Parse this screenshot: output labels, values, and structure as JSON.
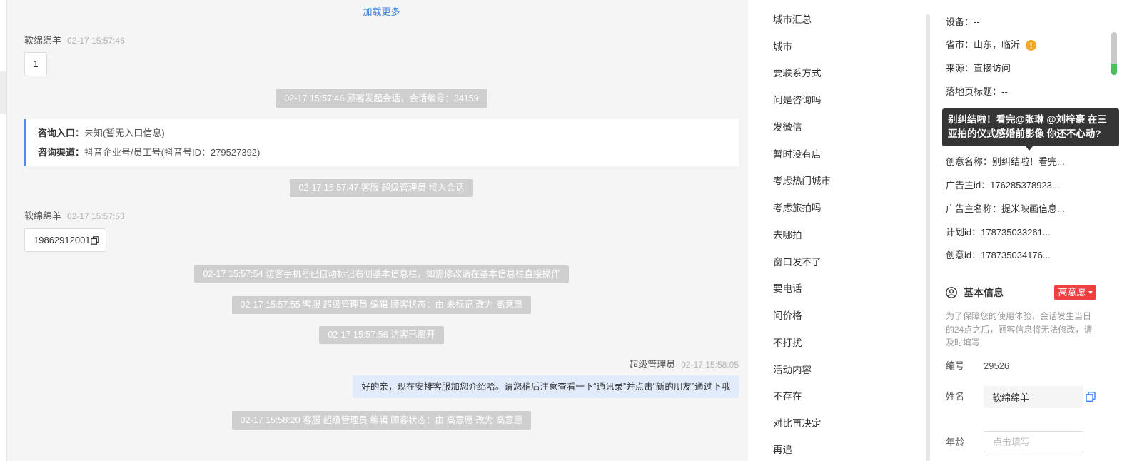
{
  "chat": {
    "load_more": "加载更多",
    "msg1": {
      "sender": "软绵绵羊",
      "time": "02-17 15:57:46",
      "text": "1"
    },
    "sys1": "02-17 15:57:46 顾客发起会话，会话编号：34159",
    "entry_info": {
      "entry_label": "咨询入口：",
      "entry_value": "未知(暂无入口信息)",
      "channel_label": "咨询渠道：",
      "channel_value": "抖音企业号/员工号(抖音号ID：279527392)"
    },
    "sys2": "02-17 15:57:47 客服 超级管理员 接入会话",
    "msg2": {
      "sender": "软绵绵羊",
      "time": "02-17 15:57:53",
      "text": "19862912001"
    },
    "sys3": "02-17 15:57:54 访客手机号已自动标记右侧基本信息栏，如需修改请在基本信息栏直接操作",
    "sys4": "02-17 15:57:55 客服 超级管理员 编辑 顾客状态：由 未标记 改为 高意愿",
    "sys5": "02-17 15:57:56 访客已离开",
    "msg3": {
      "sender": "超级管理员",
      "time": "02-17 15:58:05",
      "text": "好的亲，现在安排客服加您介绍哈。请您稍后注意查看一下“通讯录”并点击“新的朋友”通过下哦"
    },
    "sys6": "02-17 15:58:20 客服 超级管理员 编辑 顾客状态：由 高意愿 改为 高意愿"
  },
  "quick_replies": [
    "城市汇总",
    "城市",
    "要联系方式",
    "问是咨询吗",
    "发微信",
    "暂时没有店",
    "考虑热门城市",
    "考虑旅拍吗",
    "去哪拍",
    "窗口发不了",
    "要电话",
    "问价格",
    "不打扰",
    "活动内容",
    "不存在",
    "对比再决定",
    "再追"
  ],
  "customer_info": {
    "device": {
      "label": "设备：",
      "value": "--"
    },
    "province": {
      "label": "省市：",
      "value": "山东，临沂"
    },
    "source": {
      "label": "来源：",
      "value": "直接访问"
    },
    "landing_title": {
      "label": "落地页标题：",
      "value": "--"
    },
    "tooltip": "别纠结啦！看完@张琳 @刘梓豪 在三亚拍的仪式感婚前影像 你还不心动?",
    "creative_name": {
      "label": "创意名称：",
      "value": "别纠结啦！看完..."
    },
    "advertiser_id": {
      "label": "广告主id：",
      "value": "176285378923..."
    },
    "advertiser_name": {
      "label": "广告主名称：",
      "value": "提米映画信息..."
    },
    "plan_id": {
      "label": "计划id：",
      "value": "178735033261..."
    },
    "creative_id": {
      "label": "创意id：",
      "value": "178735034176..."
    },
    "basic_info": {
      "title": "基本信息",
      "status": "高意愿",
      "hint": "为了保障您的使用体验，会话发生当日的24点之后，顾客信息将无法修改，请及时填写"
    },
    "fields": {
      "number": {
        "label": "编号",
        "value": "29526"
      },
      "name": {
        "label": "姓名",
        "value": "软绵绵羊"
      },
      "age": {
        "label": "年龄",
        "placeholder": "点击填写"
      }
    }
  },
  "colors": {
    "link": "#3d80de",
    "entry_accent": "#4b8df8",
    "status_badge": "#ef3f3f",
    "warning_icon": "#f5a623",
    "copy_icon": "#3b7ff0",
    "scroll_indicator": "#46c25a"
  },
  "icons": {
    "phone_copy": "copy-icon",
    "province_notice": "warning-info-icon",
    "basic_info": "user-circle-icon",
    "status_dropdown": "caret-down-icon",
    "name_copy": "copy-icon"
  }
}
